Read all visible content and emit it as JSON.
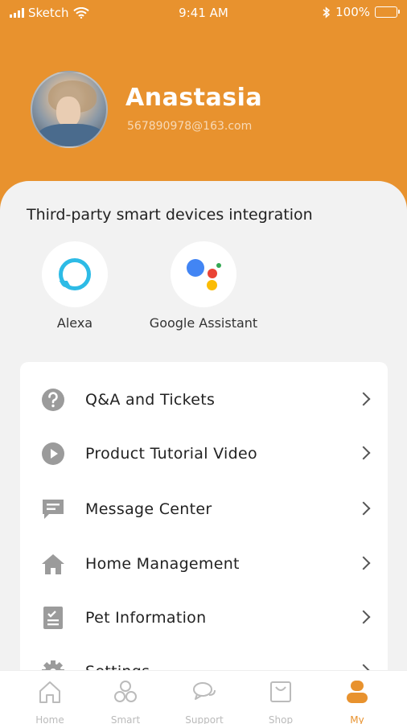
{
  "status_bar": {
    "carrier": "Sketch",
    "time": "9:41 AM",
    "battery": "100%"
  },
  "profile": {
    "name": "Anastasia",
    "email": "567890978@163.com"
  },
  "integrations": {
    "title": "Third-party smart devices integration",
    "items": [
      {
        "label": "Alexa",
        "icon": "alexa-icon"
      },
      {
        "label": "Google Assistant",
        "icon": "google-assistant-icon"
      }
    ]
  },
  "menu": {
    "items": [
      {
        "label": "Q&A and Tickets",
        "icon": "question-circle-icon"
      },
      {
        "label": "Product Tutorial Video",
        "icon": "play-circle-icon"
      },
      {
        "label": "Message Center",
        "icon": "message-icon"
      },
      {
        "label": "Home Management",
        "icon": "home-icon"
      },
      {
        "label": "Pet Information",
        "icon": "clipboard-icon"
      },
      {
        "label": "Settings",
        "icon": "gear-icon"
      }
    ]
  },
  "tabbar": {
    "tabs": [
      {
        "label": "Home",
        "icon": "home-outline-icon",
        "active": false
      },
      {
        "label": "Smart",
        "icon": "smart-icon",
        "active": false
      },
      {
        "label": "Support",
        "icon": "chat-bubbles-icon",
        "active": false
      },
      {
        "label": "Shop",
        "icon": "shopping-bag-icon",
        "active": false
      },
      {
        "label": "My",
        "icon": "person-icon",
        "active": true
      }
    ]
  },
  "colors": {
    "accent": "#e8922e",
    "alexa": "#2dbbe6",
    "icon_gray": "#9b9b9b",
    "tab_inactive": "#bbbbbb"
  }
}
